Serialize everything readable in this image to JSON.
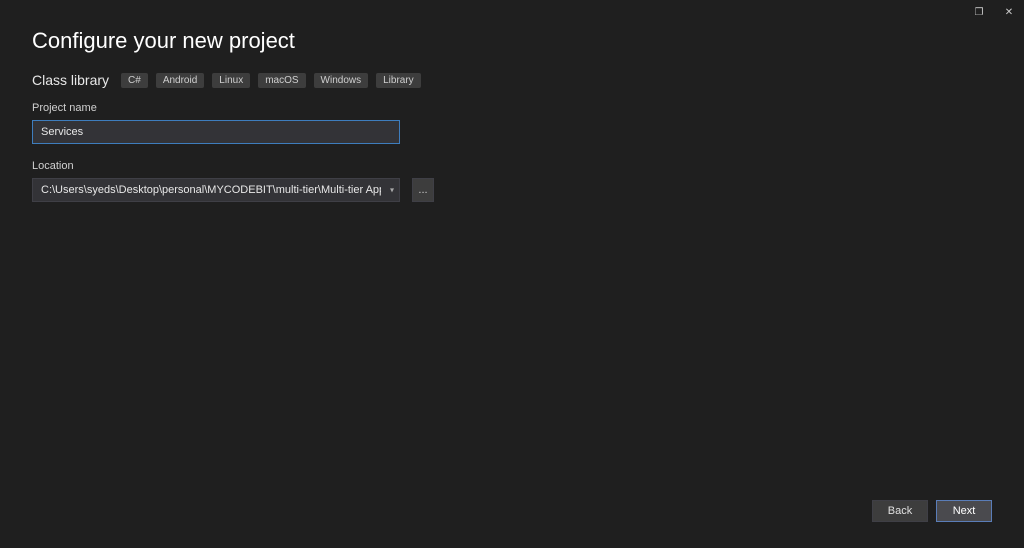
{
  "window": {
    "maximize_glyph": "❐",
    "close_glyph": "✕"
  },
  "header": {
    "title": "Configure your new project",
    "template_name": "Class library",
    "tags": [
      "C#",
      "Android",
      "Linux",
      "macOS",
      "Windows",
      "Library"
    ]
  },
  "fields": {
    "project_name_label": "Project name",
    "project_name_value": "Services",
    "location_label": "Location",
    "location_value": "C:\\Users\\syeds\\Desktop\\personal\\MYCODEBIT\\multi-tier\\Multi-tier Application",
    "browse_label": "..."
  },
  "footer": {
    "back_label": "Back",
    "next_label": "Next"
  }
}
